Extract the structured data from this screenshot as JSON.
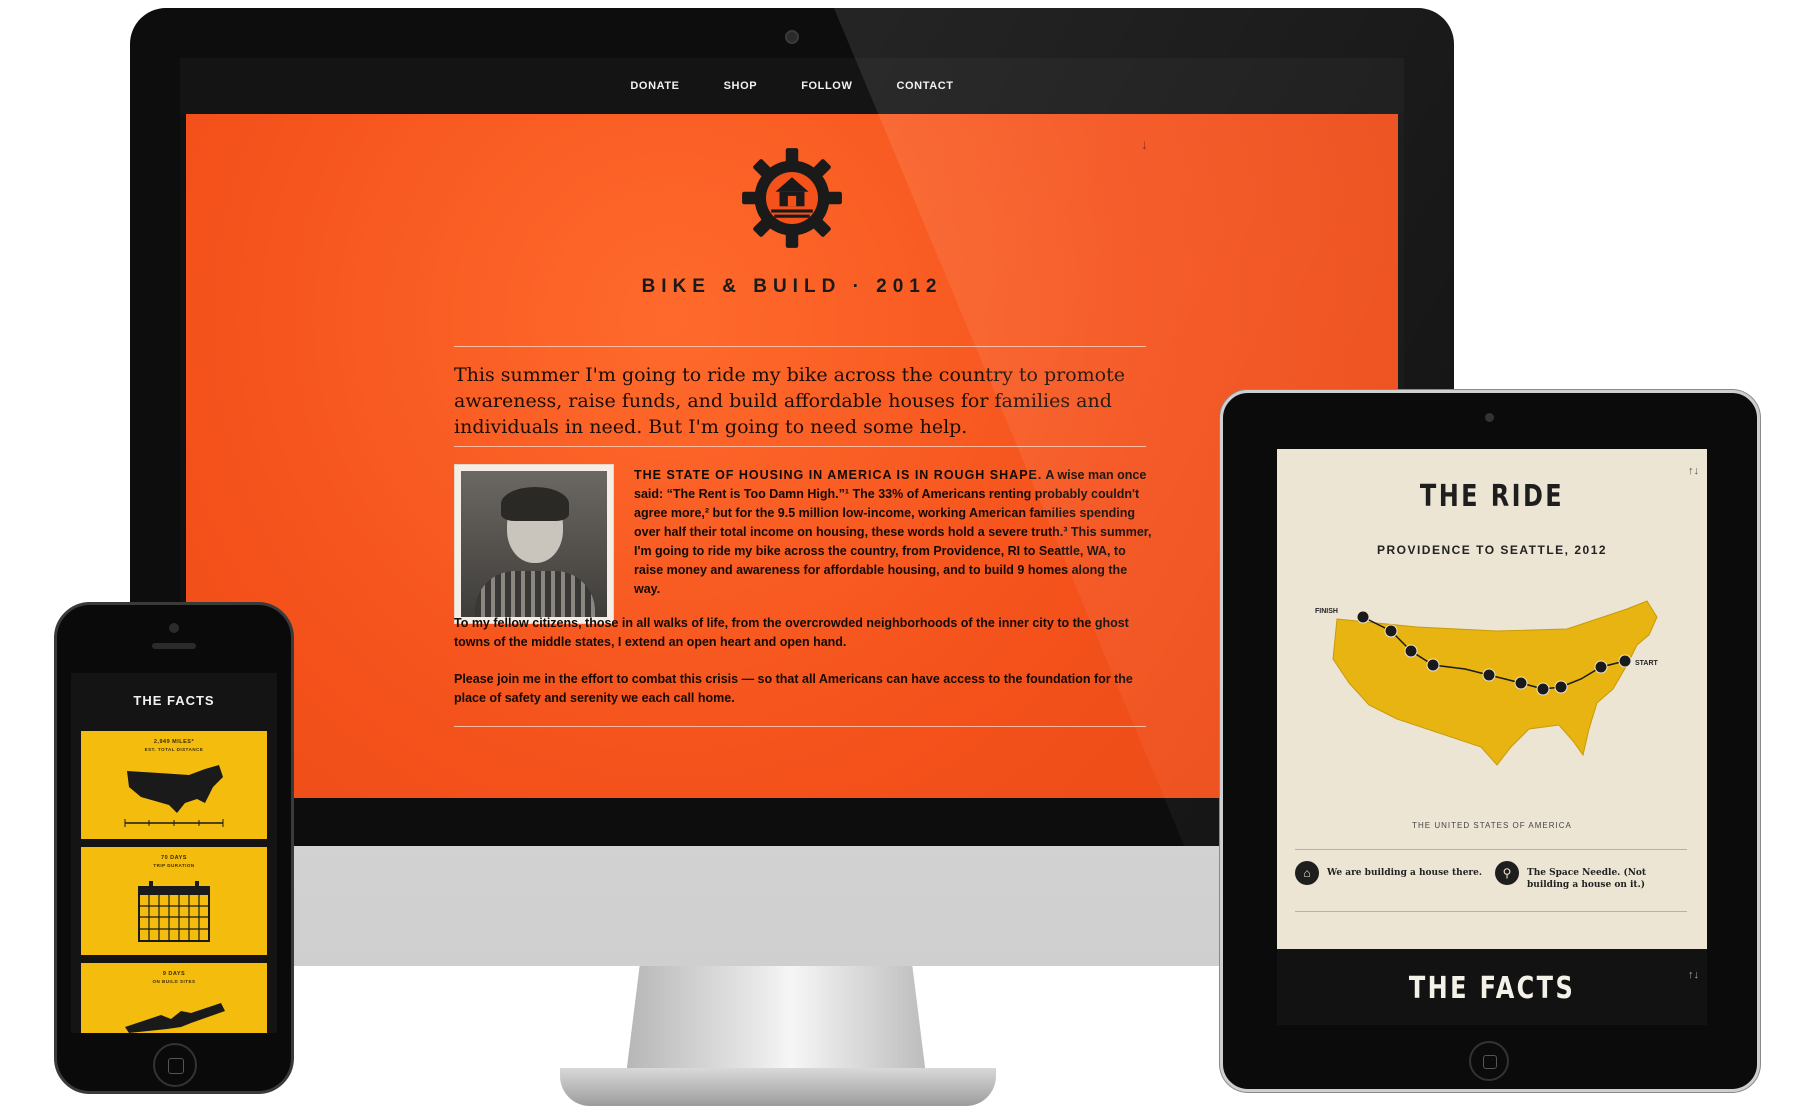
{
  "desktop": {
    "nav": [
      "DONATE",
      "SHOP",
      "FOLLOW",
      "CONTACT"
    ],
    "scroll_arrow": "↓",
    "site_title": "BIKE & BUILD · 2012",
    "lede": "This summer I'm going to ride my bike across the country to promote awareness, raise funds, and build affordable houses for families and individuals in need. But I'm going to need some help.",
    "body_caps": "THE STATE OF HOUSING IN AMERICA IS IN ROUGH SHAPE.",
    "body_rest": " A wise man once said: “The Rent is Too Damn High.”¹  The 33% of Americans renting probably couldn't agree more,²  but for the 9.5 million low-income, working American families spending over half their total income on housing, these words hold a severe truth.³  This summer, I'm going to ride my bike across the country, from Providence, RI to Seattle, WA, to raise money and awareness for affordable housing, and to build 9 homes along the way.",
    "para1": "To my fellow citizens, those in all walks of life, from the overcrowded neighborhoods of the inner city to the ghost towns of the middle states, I extend an open heart and open hand.",
    "para2": "Please join me in the effort to combat this crisis — so that all Americans can have access to the foundation for the place of safety and serenity we each call home."
  },
  "tablet": {
    "updown": "↑↓",
    "ride_title": "THE RIDE",
    "ride_subtitle": "PROVIDENCE TO SEATTLE, 2012",
    "map_finish": "FINISH",
    "map_start": "START",
    "map_caption": "THE UNITED STATES OF AMERICA",
    "legend_house": "We are building a house there.",
    "legend_needle": "The Space Needle. (Not building a house on it.)",
    "facts_title": "THE FACTS",
    "facts_updown": "↑↓"
  },
  "phone": {
    "facts_title": "THE FACTS",
    "cards": [
      {
        "title": "2,949 MILES*",
        "subtitle": "EST. TOTAL DISTANCE"
      },
      {
        "title": "70 DAYS",
        "subtitle": "TRIP DURATION"
      },
      {
        "title": "9 DAYS",
        "subtitle": "ON BUILD SITES"
      }
    ]
  },
  "colors": {
    "hero_orange": "#f4511b",
    "map_yellow": "#e8b412",
    "card_yellow": "#f4bd0d",
    "paper": "#ece5d4"
  }
}
